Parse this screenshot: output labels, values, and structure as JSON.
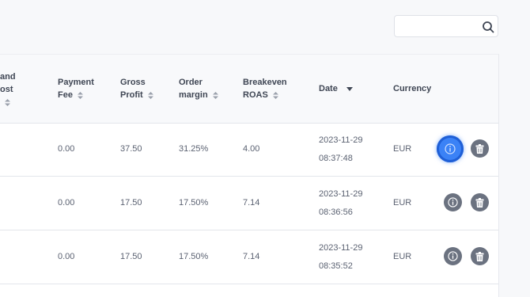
{
  "search": {
    "placeholder": "",
    "value": ""
  },
  "columns": {
    "cost": {
      "line1": "and",
      "line2": "ost"
    },
    "payment_fee": {
      "line1": "Payment",
      "line2": "Fee"
    },
    "gross_profit": {
      "line1": "Gross",
      "line2": "Profit"
    },
    "order_margin": {
      "line1": "Order",
      "line2": "margin"
    },
    "breakeven_roas": {
      "line1": "Breakeven",
      "line2": "ROAS"
    },
    "date": "Date",
    "currency": "Currency"
  },
  "rows": [
    {
      "payment_fee": "0.00",
      "gross_profit": "37.50",
      "order_margin": "31.25%",
      "breakeven_roas": "4.00",
      "date": "2023-11-29",
      "time": "08:37:48",
      "currency": "EUR"
    },
    {
      "payment_fee": "0.00",
      "gross_profit": "17.50",
      "order_margin": "17.50%",
      "breakeven_roas": "7.14",
      "date": "2023-11-29",
      "time": "08:36:56",
      "currency": "EUR"
    },
    {
      "payment_fee": "0.00",
      "gross_profit": "17.50",
      "order_margin": "17.50%",
      "breakeven_roas": "7.14",
      "date": "2023-11-29",
      "time": "08:35:52",
      "currency": "EUR"
    }
  ],
  "icons": {
    "info": "info-icon",
    "delete": "trash-icon",
    "search": "search-icon",
    "sort": "sort-icon",
    "sort_desc": "sort-desc-icon"
  },
  "colors": {
    "active_button": "#3b82f6",
    "button": "#6b7280"
  }
}
